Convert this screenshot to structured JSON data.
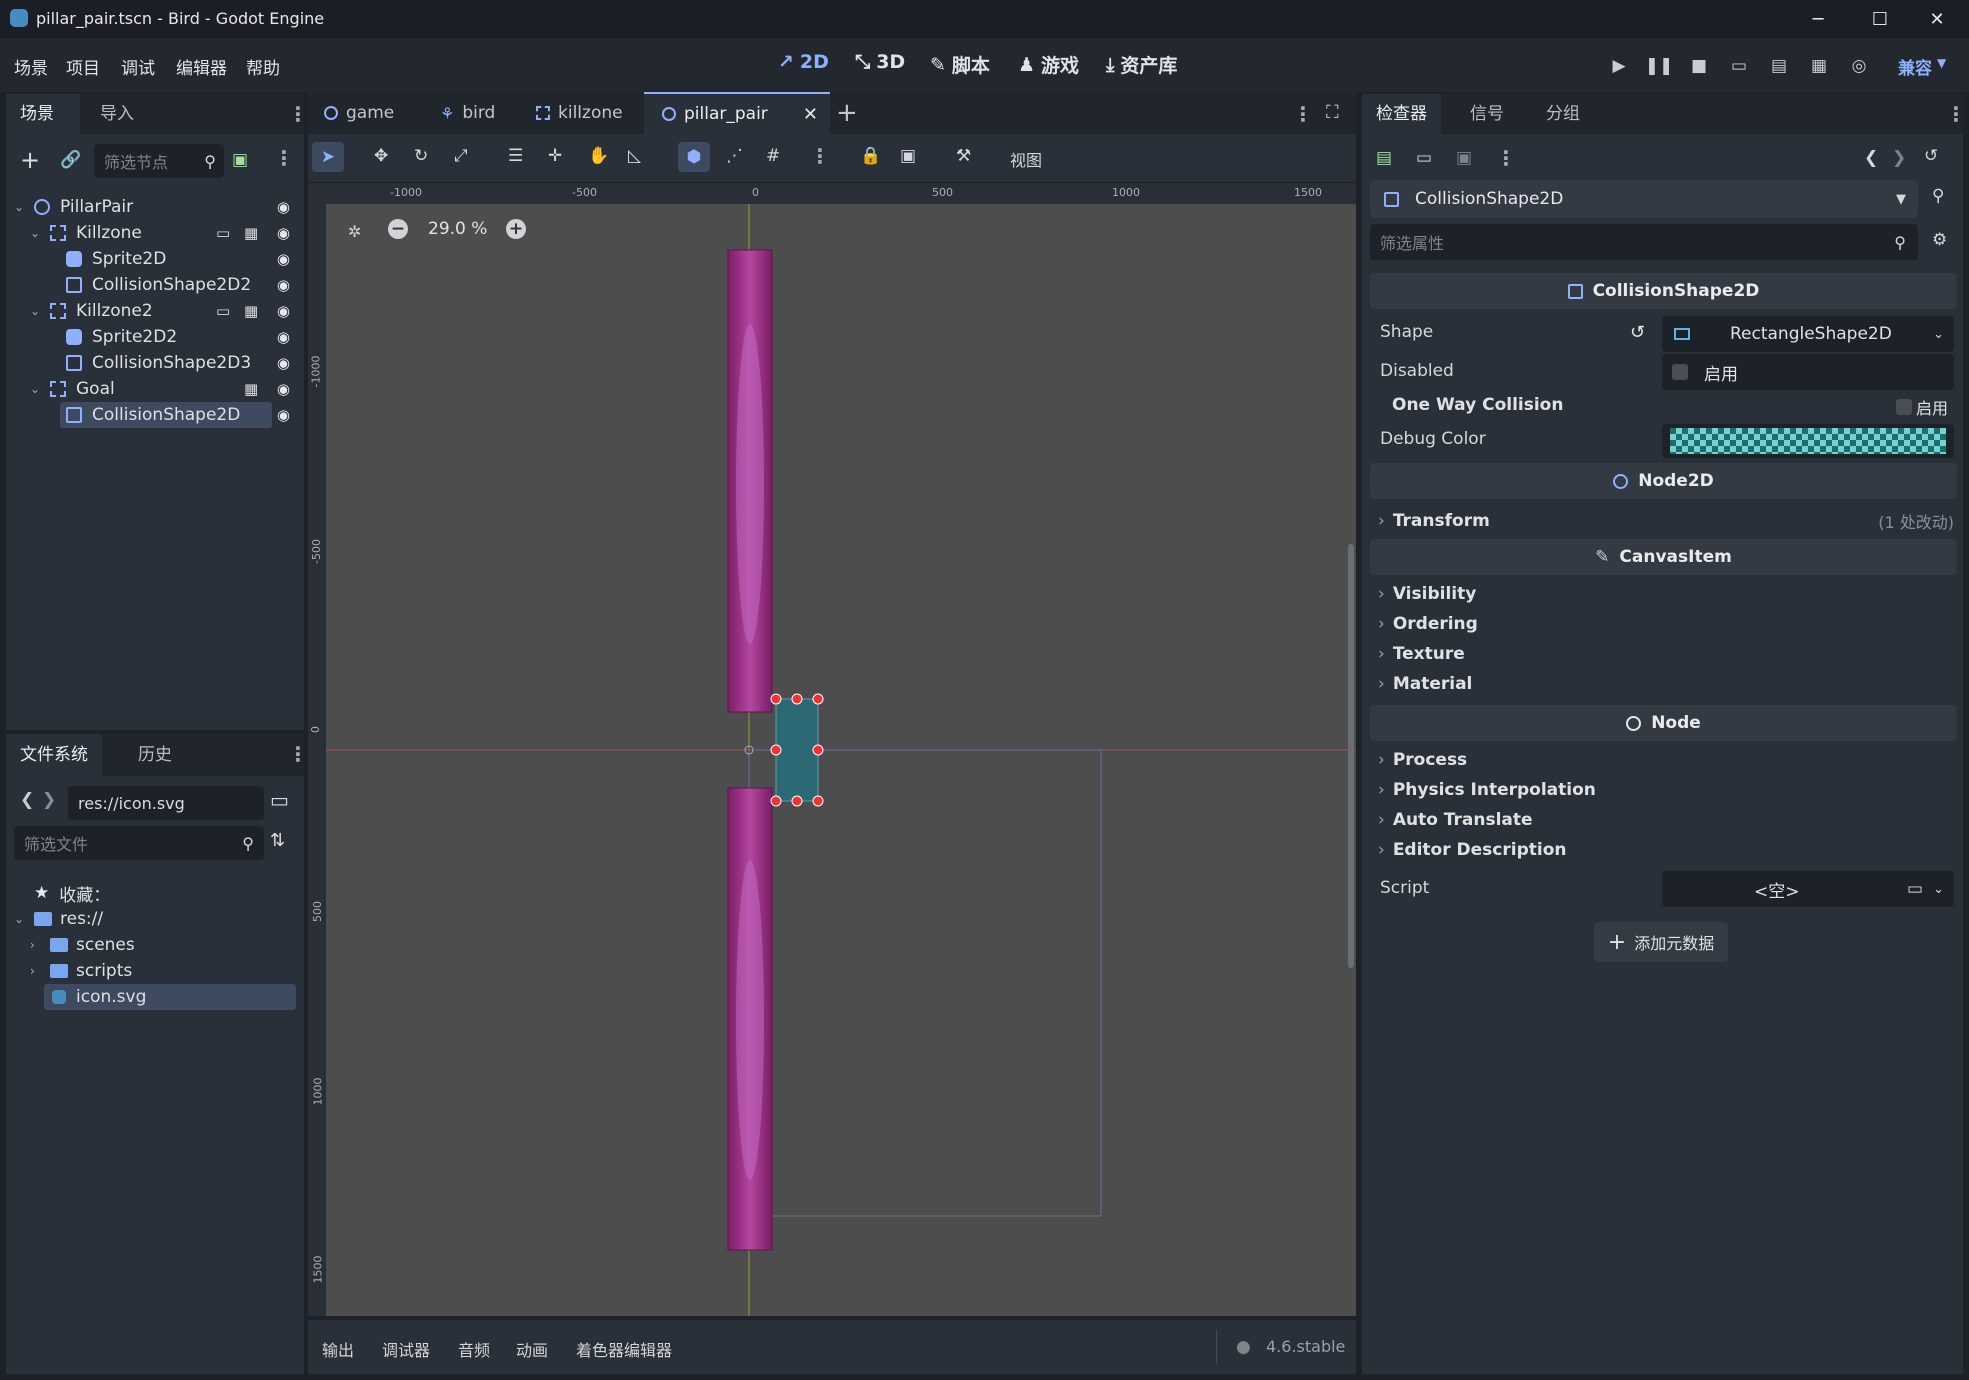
{
  "window": {
    "title": "pillar_pair.tscn - Bird - Godot Engine"
  },
  "menu": [
    "场景",
    "项目",
    "调试",
    "编辑器",
    "帮助"
  ],
  "modes": [
    {
      "label": "2D",
      "icon": "2d-icon",
      "active": true
    },
    {
      "label": "3D",
      "icon": "3d-icon"
    },
    {
      "label": "脚本",
      "icon": "script-icon"
    },
    {
      "label": "游戏",
      "icon": "game-icon"
    },
    {
      "label": "资产库",
      "icon": "assetlib-icon"
    }
  ],
  "renderer": "兼容",
  "scene_dock": {
    "tabs": [
      "场景",
      "导入"
    ],
    "filter_placeholder": "筛选节点",
    "tree": [
      {
        "name": "PillarPair",
        "icon": "node2d-icon",
        "depth": 0
      },
      {
        "name": "Killzone",
        "icon": "area2d-icon",
        "depth": 1
      },
      {
        "name": "Sprite2D",
        "icon": "sprite2d-icon",
        "depth": 2
      },
      {
        "name": "CollisionShape2D2",
        "icon": "collisionshape-icon",
        "depth": 2
      },
      {
        "name": "Killzone2",
        "icon": "area2d-icon",
        "depth": 1
      },
      {
        "name": "Sprite2D2",
        "icon": "sprite2d-icon",
        "depth": 2
      },
      {
        "name": "CollisionShape2D3",
        "icon": "collisionshape-icon",
        "depth": 2
      },
      {
        "name": "Goal",
        "icon": "area2d-icon",
        "depth": 1
      },
      {
        "name": "CollisionShape2D",
        "icon": "collisionshape-icon",
        "depth": 2,
        "selected": true
      }
    ]
  },
  "fs_dock": {
    "tabs": [
      "文件系统",
      "历史"
    ],
    "path": "res://icon.svg",
    "filter_placeholder": "筛选文件",
    "favorites": "收藏：",
    "root": "res://",
    "items": [
      "scenes",
      "scripts",
      "icon.svg"
    ]
  },
  "editor_tabs": [
    "game",
    "bird",
    "killzone",
    "pillar_pair"
  ],
  "toolbar": {
    "view": "视图"
  },
  "zoom": "29.0 %",
  "ruler_h": [
    "-1000",
    "-500",
    "0",
    "500",
    "1000",
    "1500"
  ],
  "ruler_v": [
    "-1000",
    "-500",
    "0",
    "500",
    "1000",
    "1500"
  ],
  "bottom_tabs": [
    "输出",
    "调试器",
    "音频",
    "动画",
    "着色器编辑器"
  ],
  "version": "4.6.stable",
  "inspector": {
    "tabs": [
      "检查器",
      "信号",
      "分组"
    ],
    "node": "CollisionShape2D",
    "filter_placeholder": "筛选属性",
    "section1": "CollisionShape2D",
    "shape_label": "Shape",
    "shape_value": "RectangleShape2D",
    "disabled_label": "Disabled",
    "enabled_text": "启用",
    "one_way_label": "One Way Collision",
    "debug_color_label": "Debug Color",
    "section2": "Node2D",
    "transform": "Transform",
    "transform_changes": "(1 处改动)",
    "section3": "CanvasItem",
    "canvas_props": [
      "Visibility",
      "Ordering",
      "Texture",
      "Material"
    ],
    "section4": "Node",
    "node_props": [
      "Process",
      "Physics Interpolation",
      "Auto Translate",
      "Editor Description"
    ],
    "script_label": "Script",
    "script_value": "<空>",
    "add_meta": "添加元数据"
  },
  "colors": {
    "accent": "#8fb0ff",
    "selection": "#3d4a5f",
    "pillar": "#8e2a7a",
    "shape": "#2a6b7a"
  }
}
